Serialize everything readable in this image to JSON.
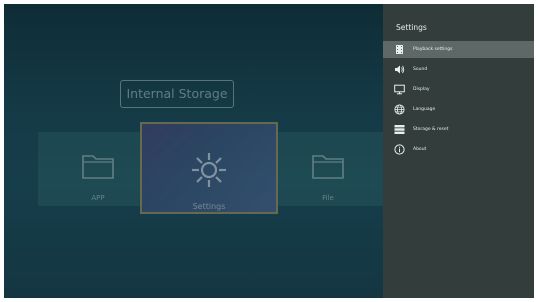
{
  "launcher": {
    "storage_title": "Internal Storage",
    "apps": [
      {
        "label": "APP",
        "icon": "folder-icon"
      },
      {
        "label": "Settings",
        "icon": "gear-icon"
      },
      {
        "label": "File",
        "icon": "folder-icon"
      }
    ]
  },
  "settings": {
    "title": "Settings",
    "items": [
      {
        "label": "Playback settings",
        "icon": "playback-icon",
        "selected": true
      },
      {
        "label": "Sound",
        "icon": "sound-icon"
      },
      {
        "label": "Display",
        "icon": "display-icon"
      },
      {
        "label": "Language",
        "icon": "globe-icon"
      },
      {
        "label": "Storage & reset",
        "icon": "storage-icon"
      },
      {
        "label": "About",
        "icon": "info-icon"
      }
    ]
  },
  "colors": {
    "panel_bg": "#333d3b",
    "selected_bg": "#5e6866",
    "focus_border": "#a98f55",
    "background": "#143a46"
  }
}
